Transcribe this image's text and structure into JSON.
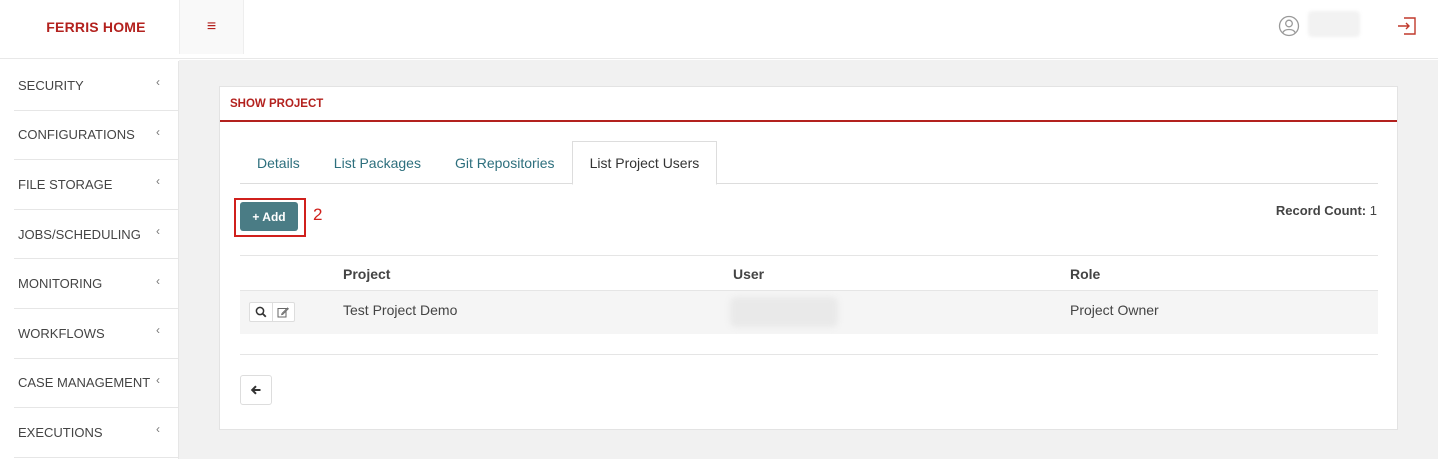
{
  "header": {
    "brand": "FERRIS HOME",
    "menu_icon": "hamburger-icon",
    "user_icon": "user-circle-icon",
    "logout_icon": "logout-icon"
  },
  "sidebar": {
    "items": [
      {
        "label": "SECURITY"
      },
      {
        "label": "CONFIGURATIONS"
      },
      {
        "label": "FILE STORAGE"
      },
      {
        "label": "JOBS/SCHEDULING"
      },
      {
        "label": "MONITORING"
      },
      {
        "label": "WORKFLOWS"
      },
      {
        "label": "CASE MANAGEMENT"
      },
      {
        "label": "EXECUTIONS"
      }
    ],
    "chevron": "‹"
  },
  "card": {
    "title": "SHOW PROJECT",
    "tabs": [
      {
        "label": "Details",
        "active": false
      },
      {
        "label": "List Packages",
        "active": false
      },
      {
        "label": "Git Repositories",
        "active": false
      },
      {
        "label": "List Project Users",
        "active": true
      }
    ],
    "add_label": "+ Add",
    "step_annotation": "2",
    "record_count_label": "Record Count:",
    "record_count_value": "1"
  },
  "table": {
    "columns": [
      "Project",
      "User",
      "Role"
    ],
    "rows": [
      {
        "project": "Test Project Demo",
        "user": "",
        "role": "Project Owner"
      }
    ]
  },
  "colors": {
    "brand": "#b3211e",
    "accent_button": "#4a7c85",
    "tab_link": "#2d6f7d",
    "annotation": "#d0201c"
  }
}
